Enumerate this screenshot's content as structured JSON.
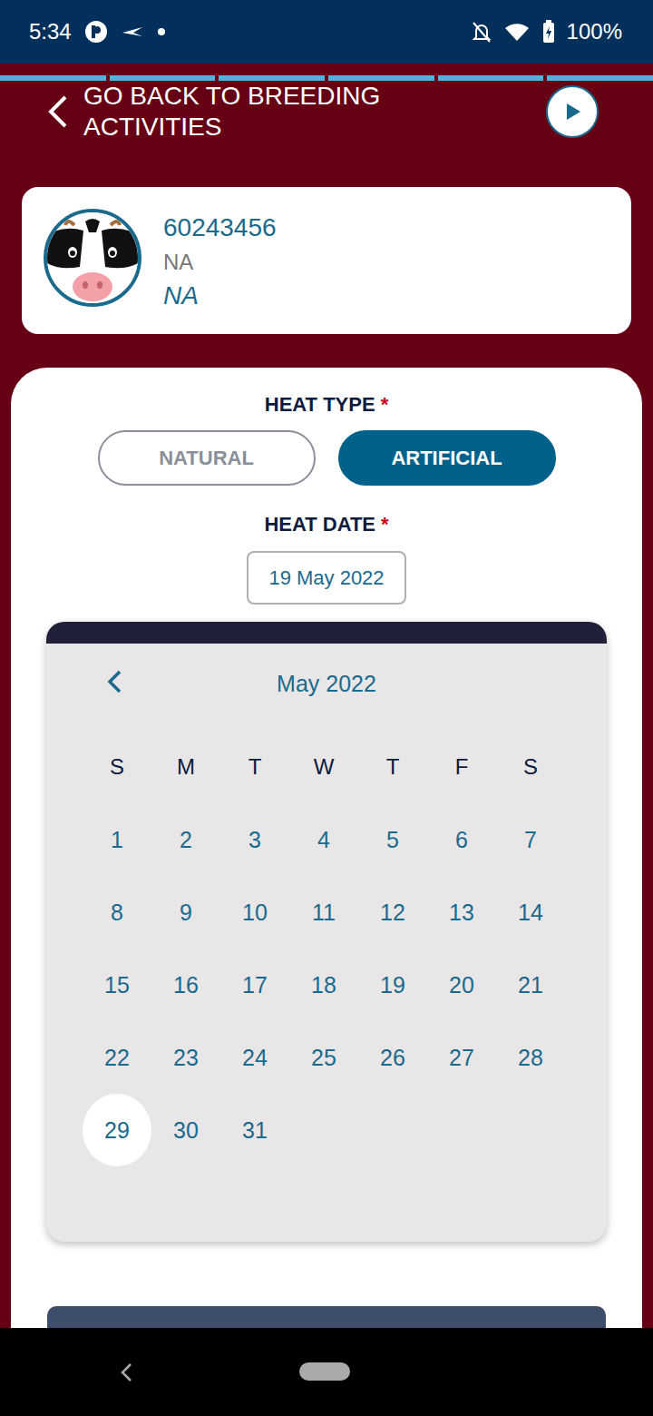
{
  "status_bar": {
    "time": "5:34",
    "battery": "100%"
  },
  "header": {
    "back_label": "GO BACK TO BREEDING ACTIVITIES"
  },
  "animal": {
    "id": "60243456",
    "line1": "NA",
    "line2": "NA"
  },
  "heat_type": {
    "label": "HEAT TYPE",
    "required": "*",
    "options": [
      {
        "label": "NATURAL",
        "selected": false
      },
      {
        "label": "ARTIFICIAL",
        "selected": true
      }
    ]
  },
  "heat_date": {
    "label": "HEAT DATE",
    "required": "*",
    "value": "19 May 2022"
  },
  "calendar": {
    "month": "May 2022",
    "weekdays": [
      "S",
      "M",
      "T",
      "W",
      "T",
      "F",
      "S"
    ],
    "days": [
      {
        "label": "1",
        "selected": false
      },
      {
        "label": "2",
        "selected": false
      },
      {
        "label": "3",
        "selected": false
      },
      {
        "label": "4",
        "selected": false
      },
      {
        "label": "5",
        "selected": false
      },
      {
        "label": "6",
        "selected": false
      },
      {
        "label": "7",
        "selected": false
      },
      {
        "label": "8",
        "selected": false
      },
      {
        "label": "9",
        "selected": false
      },
      {
        "label": "10",
        "selected": false
      },
      {
        "label": "11",
        "selected": false
      },
      {
        "label": "12",
        "selected": false
      },
      {
        "label": "13",
        "selected": false
      },
      {
        "label": "14",
        "selected": false
      },
      {
        "label": "15",
        "selected": false
      },
      {
        "label": "16",
        "selected": false
      },
      {
        "label": "17",
        "selected": false
      },
      {
        "label": "18",
        "selected": false
      },
      {
        "label": "19",
        "selected": false
      },
      {
        "label": "20",
        "selected": false
      },
      {
        "label": "21",
        "selected": false
      },
      {
        "label": "22",
        "selected": false
      },
      {
        "label": "23",
        "selected": false
      },
      {
        "label": "24",
        "selected": false
      },
      {
        "label": "25",
        "selected": false
      },
      {
        "label": "26",
        "selected": false
      },
      {
        "label": "27",
        "selected": false
      },
      {
        "label": "28",
        "selected": false
      },
      {
        "label": "29",
        "selected": true
      },
      {
        "label": "30",
        "selected": false
      },
      {
        "label": "31",
        "selected": false
      }
    ]
  }
}
